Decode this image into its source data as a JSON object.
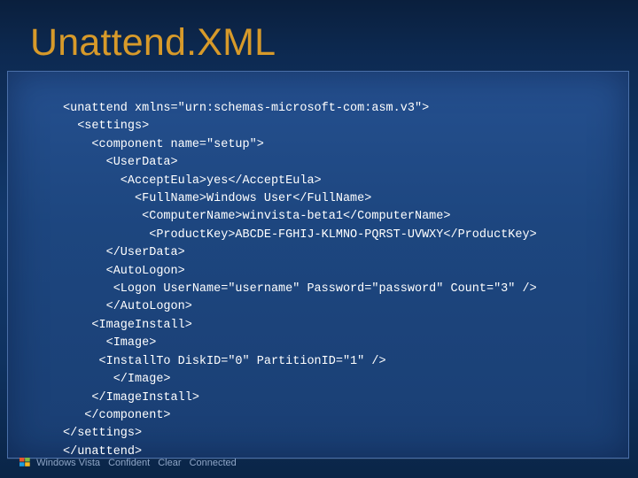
{
  "slide": {
    "title": "Unattend.XML"
  },
  "code": {
    "lines": [
      "<unattend xmlns=\"urn:schemas-microsoft-com:asm.v3\">",
      "  <settings>",
      "    <component name=\"setup\">",
      "      <UserData>",
      "        <AcceptEula>yes</AcceptEula>",
      "          <FullName>Windows User</FullName>",
      "           <ComputerName>winvista-beta1</ComputerName>",
      "            <ProductKey>ABCDE-FGHIJ-KLMNO-PQRST-UVWXY</ProductKey>",
      "      </UserData>",
      "      <AutoLogon>",
      "       <Logon UserName=\"username\" Password=\"password\" Count=\"3\" />",
      "      </AutoLogon>",
      "    <ImageInstall>",
      "      <Image>",
      "     <InstallTo DiskID=\"0\" PartitionID=\"1\" />",
      "       </Image>",
      "    </ImageInstall>",
      "   </component>",
      "</settings>",
      "</unattend>"
    ]
  },
  "footer": {
    "brand": "Windows Vista",
    "tagline_1": "Confident",
    "tagline_2": "Clear",
    "tagline_3": "Connected"
  },
  "colors": {
    "title": "#d79a2a",
    "background_top": "#0a1f3d",
    "panel": "#1d467f",
    "code_text": "#ffffff"
  },
  "icons": {
    "footer_logo": "windows-flag-icon"
  }
}
